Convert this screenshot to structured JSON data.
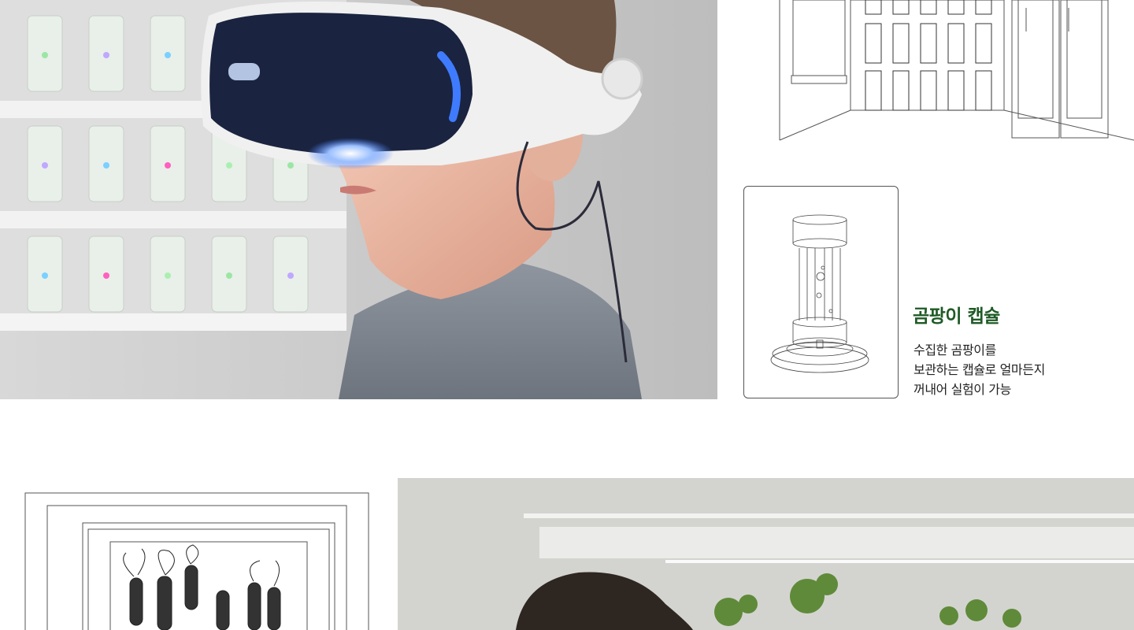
{
  "capsule": {
    "title": "곰팡이 캡슐",
    "description": [
      "수집한 곰팡이를",
      "보관하는 캡슐로 얼마든지",
      "꺼내어 실험이 가능"
    ]
  },
  "colors": {
    "title_green": "#1f5a26",
    "text": "#222222",
    "card_border": "#555555",
    "hero_bg": "#c8c8c8",
    "vr_visor": "#1a2440",
    "vr_glow": "#3f7bff"
  },
  "images": {
    "hero": "photo-child-wearing-vr-headset-in-front-of-capsule-shelves",
    "shelf_sketch": "line-drawing-capsule-shelves-with-doors",
    "capsule_sketch": "wireframe-drawing-mold-capsule",
    "frame_sketch": "line-drawing-framed-plant-tubes",
    "lab_photo": "photo-person-with-plant-shelf"
  }
}
